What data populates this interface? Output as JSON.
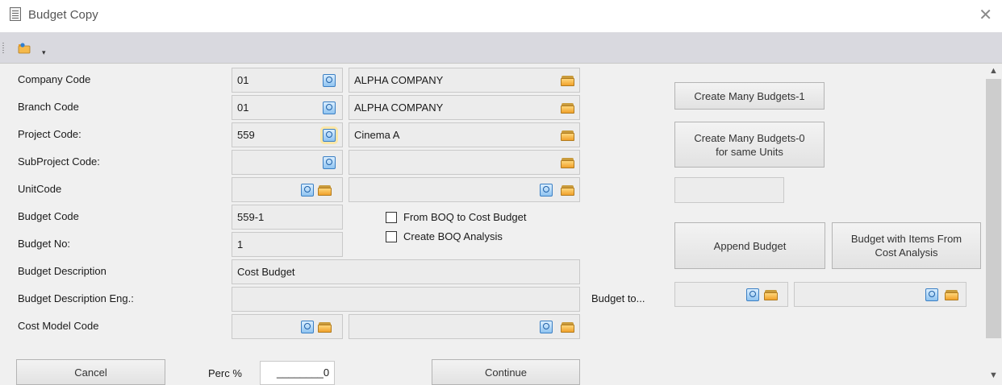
{
  "window": {
    "title": "Budget Copy"
  },
  "toolbar": {
    "button_icon": "folder-with-pen-icon",
    "dropdown_icon": "dropdown-arrow-icon"
  },
  "fields": {
    "company_code": {
      "label": "Company Code",
      "code": "01",
      "name": "ALPHA COMPANY"
    },
    "branch_code": {
      "label": "Branch Code",
      "code": "01",
      "name": "ALPHA COMPANY"
    },
    "project_code": {
      "label": "Project Code:",
      "code": "559",
      "name": "Cinema A"
    },
    "subproject_code": {
      "label": "SubProject Code:",
      "code": "",
      "name": ""
    },
    "unit_code": {
      "label": "UnitCode",
      "code": "",
      "name": ""
    },
    "budget_code": {
      "label": "Budget Code",
      "value": "559-1"
    },
    "budget_no": {
      "label": "Budget No:",
      "value": "1"
    },
    "budget_description": {
      "label": "Budget Description",
      "value": "Cost Budget"
    },
    "budget_description_eng": {
      "label": "Budget Description Eng.:",
      "value": ""
    },
    "cost_model_code": {
      "label": "Cost Model Code",
      "code": "",
      "name": ""
    }
  },
  "checkboxes": {
    "from_boq": {
      "label": "From BOQ to Cost Budget",
      "checked": false
    },
    "create_boq_analysis": {
      "label": "Create BOQ Analysis",
      "checked": false
    }
  },
  "right_panel": {
    "create_many_1": "Create Many Budgets-1",
    "create_many_0_line1": "Create Many Budgets-0",
    "create_many_0_line2": "for same Units",
    "extra_value": "",
    "append_budget": "Append Budget",
    "budget_with_items_line1": "Budget with Items From",
    "budget_with_items_line2": "Cost Analysis",
    "budget_to_label": "Budget to...",
    "budget_to_code": "",
    "budget_to_name": ""
  },
  "bottom": {
    "cancel": "Cancel",
    "perc_label": "Perc %",
    "perc_value": "________0",
    "continue": "Continue"
  },
  "colors": {
    "panel_bg": "#f0f0f0",
    "toolbar_bg": "#d9d9df",
    "field_bg": "#ececec",
    "lookup_blue": "#3b7fc4",
    "folder_orange": "#f0a12b"
  }
}
